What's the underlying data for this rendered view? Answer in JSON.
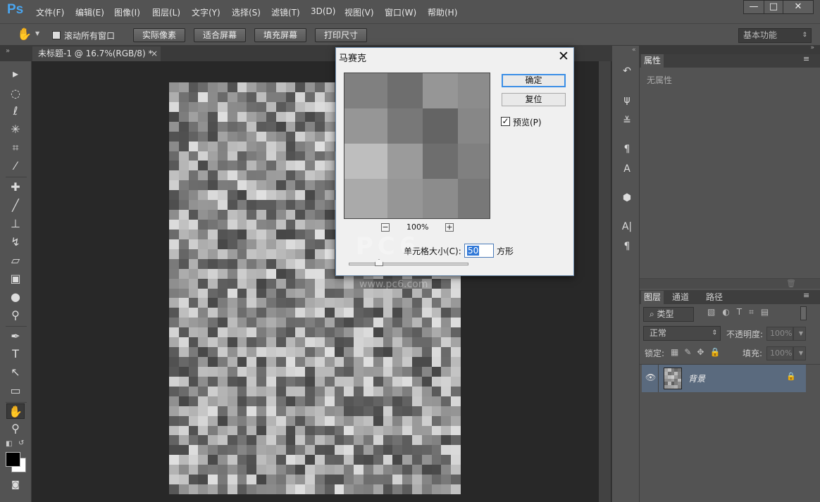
{
  "app": {
    "logo": "Ps"
  },
  "menu": [
    "文件(F)",
    "编辑(E)",
    "图像(I)",
    "图层(L)",
    "文字(Y)",
    "选择(S)",
    "滤镜(T)",
    "3D(D)",
    "视图(V)",
    "窗口(W)",
    "帮助(H)"
  ],
  "window_controls": {
    "minimize": "—",
    "maximize": "□",
    "close": "✕"
  },
  "options_bar": {
    "scroll_all_label": "滚动所有窗口",
    "scroll_all_checked": false,
    "actual_pixels": "实际像素",
    "fit_screen": "适合屏幕",
    "fill_screen": "填充屏幕",
    "print_size": "打印尺寸",
    "workspace": "基本功能"
  },
  "document_tab": {
    "title": "未标题-1 @ 16.7%(RGB/8) *",
    "close": "×"
  },
  "dialog": {
    "title": "马赛克",
    "ok": "确定",
    "reset": "复位",
    "preview_label": "预览(P)",
    "preview_checked": true,
    "zoom": "100%",
    "zoom_out": "−",
    "zoom_in": "+",
    "cell_size_label": "单元格大小(C):",
    "cell_size_value": "50",
    "cell_size_unit": "方形",
    "cell_size_slider_fraction": 0.2
  },
  "properties_panel": {
    "tab": "属性",
    "empty_text": "无属性"
  },
  "layers_panel": {
    "tabs": [
      "图层",
      "通道",
      "路径"
    ],
    "filter_kind": "类型",
    "blend_mode": "正常",
    "opacity_label": "不透明度:",
    "opacity_value": "100%",
    "lock_label": "锁定:",
    "fill_label": "填充:",
    "fill_value": "100%",
    "layers": [
      {
        "name": "背景",
        "visible": true,
        "locked": true
      }
    ]
  },
  "watermark": {
    "text": "www.pc6.com",
    "logo": "PC6"
  }
}
